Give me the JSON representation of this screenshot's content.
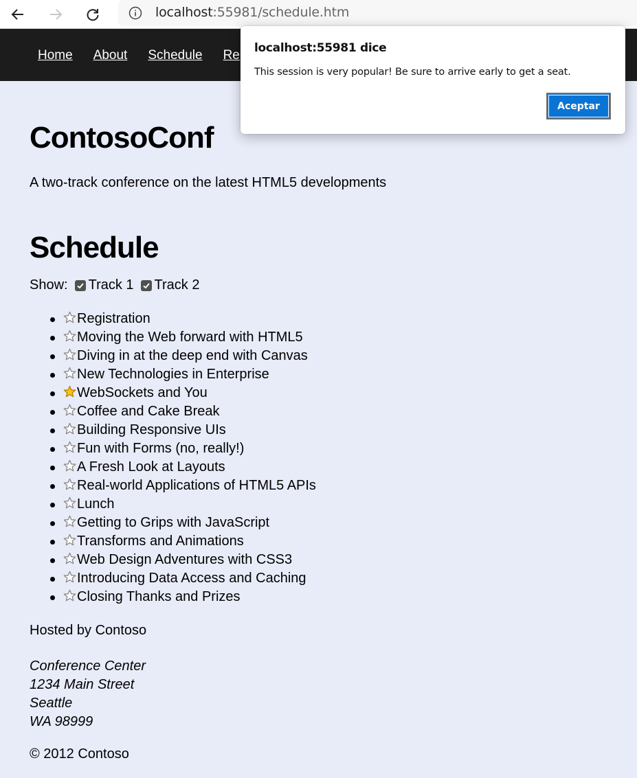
{
  "browser": {
    "url_host": "localhost",
    "url_rest": ":55981/schedule.htm"
  },
  "nav": {
    "items": [
      {
        "label": "Home"
      },
      {
        "label": "About"
      },
      {
        "label": "Schedule"
      },
      {
        "label": "Re"
      }
    ]
  },
  "site": {
    "title": "ContosoConf",
    "tagline": "A two-track conference on the latest HTML5 developments"
  },
  "schedule": {
    "heading": "Schedule",
    "show_label": "Show:",
    "track1_label": "Track 1",
    "track2_label": "Track 2",
    "sessions": [
      {
        "title": "Registration",
        "starred": false
      },
      {
        "title": "Moving the Web forward with HTML5",
        "starred": false
      },
      {
        "title": "Diving in at the deep end with Canvas",
        "starred": false
      },
      {
        "title": "New Technologies in Enterprise",
        "starred": false
      },
      {
        "title": "WebSockets and You",
        "starred": true
      },
      {
        "title": "Coffee and Cake Break",
        "starred": false
      },
      {
        "title": "Building Responsive UIs",
        "starred": false
      },
      {
        "title": "Fun with Forms (no, really!)",
        "starred": false
      },
      {
        "title": "A Fresh Look at Layouts",
        "starred": false
      },
      {
        "title": "Real-world Applications of HTML5 APIs",
        "starred": false
      },
      {
        "title": "Lunch",
        "starred": false
      },
      {
        "title": "Getting to Grips with JavaScript",
        "starred": false
      },
      {
        "title": "Transforms and Animations",
        "starred": false
      },
      {
        "title": "Web Design Adventures with CSS3",
        "starred": false
      },
      {
        "title": "Introducing Data Access and Caching",
        "starred": false
      },
      {
        "title": "Closing Thanks and Prizes",
        "starred": false
      }
    ]
  },
  "footer": {
    "hosted": "Hosted by Contoso",
    "address_line1": "Conference Center",
    "address_line2": "1234 Main Street",
    "address_line3": "Seattle",
    "address_line4": "WA 98999",
    "copyright": "© 2012 Contoso"
  },
  "dialog": {
    "title": "localhost:55981 dice",
    "message": "This session is very popular! Be sure to arrive early to get a seat.",
    "button_label": "Aceptar"
  },
  "colors": {
    "page_bg": "#e8ecf8",
    "header_bg": "#1c1c1c",
    "dialog_button": "#0a74d4",
    "star_gold": "#f5c518"
  }
}
